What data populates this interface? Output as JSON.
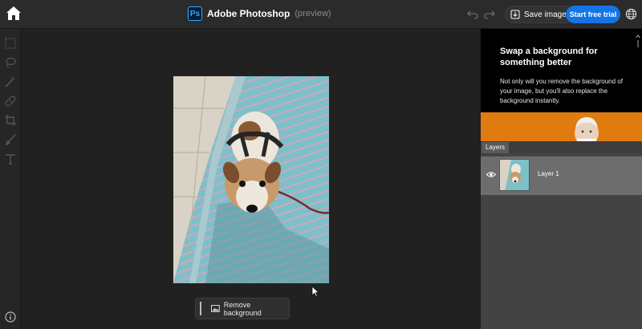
{
  "header": {
    "app_name": "Adobe Photoshop",
    "preview_tag": "(preview)",
    "ps_logo_text": "Ps",
    "save_label": "Save image",
    "trial_label": "Start free trial"
  },
  "toolbar": {
    "tools": [
      "marquee-icon",
      "lasso-icon",
      "magic-wand-icon",
      "healing-icon",
      "crop-icon",
      "brush-icon",
      "type-icon"
    ]
  },
  "canvas": {
    "remove_bg_label": "Remove background"
  },
  "promo": {
    "title": "Swap a background for something better",
    "body": "Not only will you remove the background of your image, but you'll also replace the background instantly."
  },
  "layers": {
    "tab_label": "Layers",
    "items": [
      {
        "name": "Layer 1",
        "visible": true
      }
    ]
  },
  "colors": {
    "accent": "#1473e6",
    "promo_orange": "#e07b10"
  }
}
